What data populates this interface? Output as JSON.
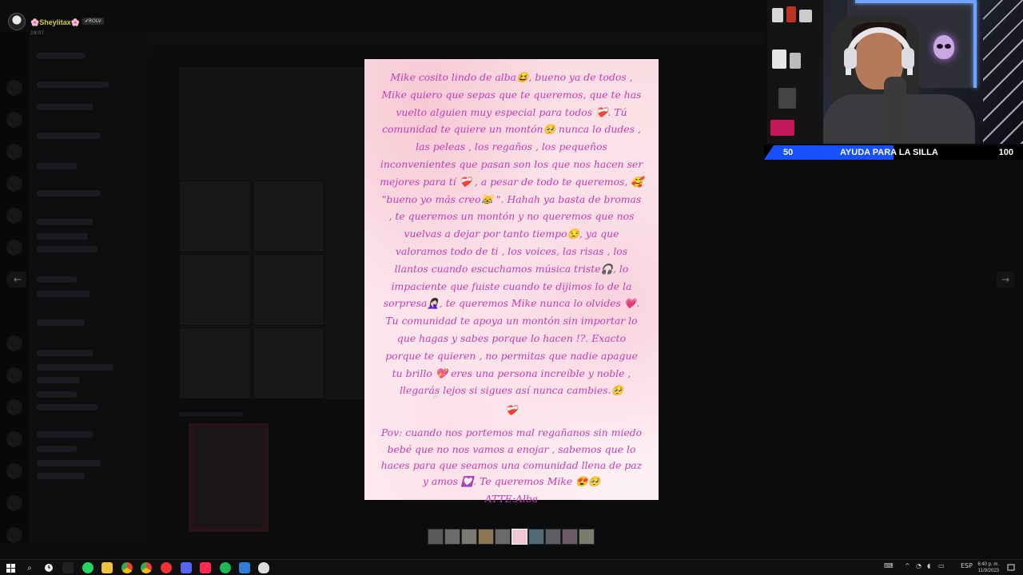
{
  "user": {
    "name": "🌸Sheylitax🌸",
    "badge": "✔ROLV",
    "time": "18:07"
  },
  "letter": {
    "paragraph1": "Mike cosito lindo de alba😆, bueno ya de todos , Mike quiero que sepas que te queremos, que te has vuelto alguien muy especial para todos ❤️‍🩹. Tú comunidad te quiere un montón🥺 nunca lo dudes , las peleas , los regaños , los pequeños inconvenientes que pasan son los que nos hacen ser mejores para tí ❤️‍🩹 , a pesar de todo te queremos, 🥰 \"bueno yo más creo😹 \". Hahah ya basta de bromas , te queremos un montón y no queremos que nos vuelvas a dejar por tanto tiempo😒, ya que valoramos todo de ti , los voices, las risas , los llantos cuando escuchamos música triste🎧, lo impaciente que fuiste cuando te dijimos lo de la sorpresa🤦🏻‍♀️, te queremos Mike nunca lo olvides 💗. Tu comunidad te apoya un montón sin importar lo que hagas y sabes porque lo hacen !?. Exacto porque te quieren , no permitas que nadie apague tu brillo 💖 eres una persona increíble y noble , llegarás lejos si sigues así nunca cambies.🥺",
    "heart": "❤️‍🩹",
    "pov": "Pov: cuando nos portemos mal regañanos sin miedo bebé que no nos vamos a enojar , sabemos que lo haces para que seamos una comunidad llena de paz y amos 💟. Te queremos Mike 😍🥺",
    "signature": "ATTE:Alba"
  },
  "goal": {
    "start": "50",
    "title": "AYUDA PARA LA SILLA",
    "end": "100",
    "progress": 0.5,
    "color": "#1650ff"
  },
  "nav": {
    "prev": "←",
    "next": "→"
  },
  "taskbar": {
    "search_icon": "⌕",
    "system_lang": "ESP",
    "time": "6:40 p. m.",
    "date": "11/9/2023"
  },
  "colors": {
    "letter_text": "#c23cb3",
    "username": "#d4cf38"
  }
}
